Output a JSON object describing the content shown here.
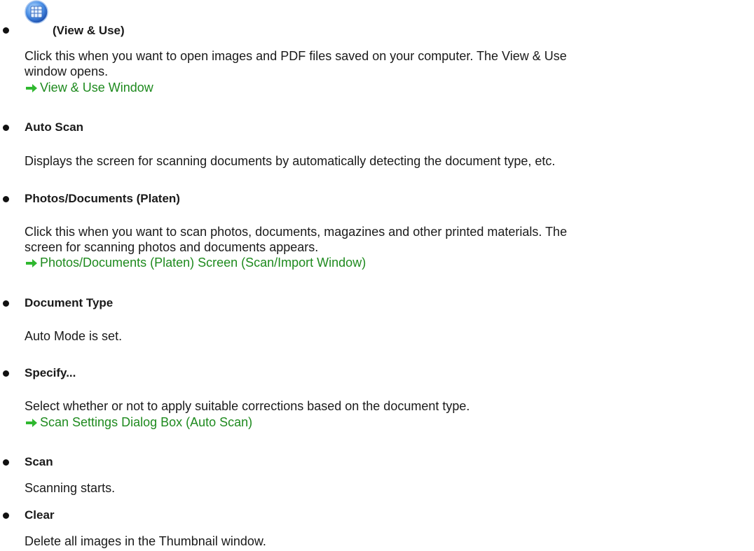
{
  "items": [
    {
      "term": "(View & Use)",
      "icon": "view-use-app-icon",
      "desc_lines": [
        "Click this when you want to open images and PDF files saved on your computer. The View & Use",
        "window opens."
      ],
      "link": "View & Use Window"
    },
    {
      "term": "Auto Scan",
      "desc_lines": [
        "Displays the screen for scanning documents by automatically detecting the document type, etc."
      ]
    },
    {
      "term": "Photos/Documents (Platen)",
      "desc_lines": [
        "Click this when you want to scan photos, documents, magazines and other printed materials. The",
        "screen for scanning photos and documents appears."
      ],
      "link": "Photos/Documents (Platen) Screen (Scan/Import Window)"
    },
    {
      "term": "Document Type",
      "desc_lines": [
        "Auto Mode is set."
      ]
    },
    {
      "term": "Specify...",
      "desc_lines": [
        "Select whether or not to apply suitable corrections based on the document type."
      ],
      "link": "Scan Settings Dialog Box (Auto Scan)"
    },
    {
      "term": "Scan",
      "desc_lines": [
        "Scanning starts."
      ]
    },
    {
      "term": "Clear",
      "desc_lines": [
        "Delete all images in the Thumbnail window."
      ]
    }
  ],
  "colors": {
    "link": "#1e8a1e",
    "link_arrow": "#2fb82f",
    "icon_blue": "#2a6fd6"
  }
}
